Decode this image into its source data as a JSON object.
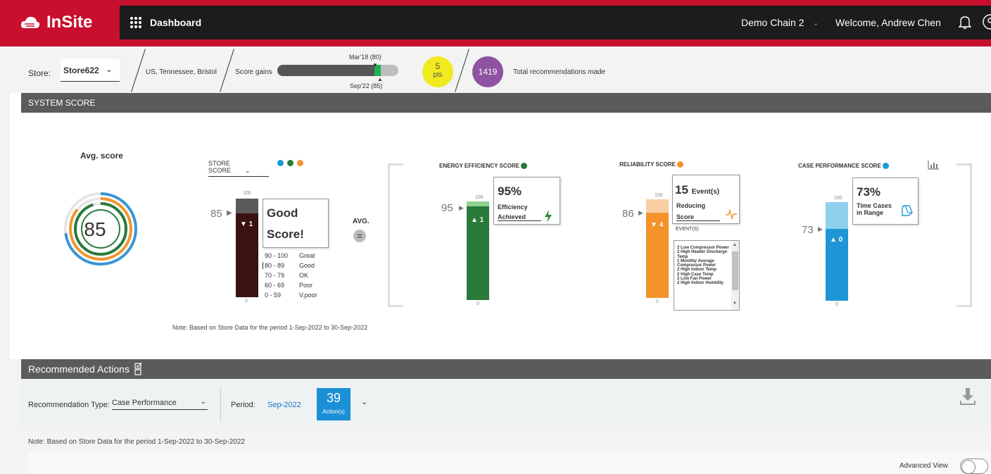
{
  "app": {
    "name": "InSite",
    "nav_title": "Dashboard",
    "chain": "Demo Chain 2",
    "welcome": "Welcome, Andrew Chen"
  },
  "store": {
    "label": "Store:",
    "value": "Store622",
    "location": "US, Tennessee, Bristol",
    "gains_label": "Score gains",
    "gains_top": "Mar'18 (80)",
    "gains_bottom": "Sep'22 (85)",
    "gains_fill": 0.8,
    "pts_value": "5",
    "pts_unit": "pts",
    "total_recs": "1419",
    "total_recs_label": "Total recommendations made"
  },
  "system_score": {
    "header": "SYSTEM SCORE",
    "avg_title": "Avg. score",
    "avg_value": "85",
    "store_score_label": "STORE SCORE",
    "store_value": "85",
    "store_delta": "▼ 1",
    "store_tick_top": "100",
    "store_tick_bottom": "0",
    "good_line1": "Good",
    "good_line2": "Score!",
    "legend": [
      {
        "range": "90 - 100",
        "label": "Great"
      },
      {
        "range": "80 - 89",
        "label": "Good"
      },
      {
        "range": "70 - 79",
        "label": "OK"
      },
      {
        "range": "60 - 69",
        "label": "Poor"
      },
      {
        "range": "0 - 59",
        "label": "V.poor"
      }
    ],
    "avg_label": "AVG.",
    "note": "Note: Based on Store Data for the period 1-Sep-2022 to 30-Sep-2022",
    "energy": {
      "title": "ENERGY EFFICIENCY SCORE",
      "value": "95",
      "delta": "▲ 1",
      "pct": "95%",
      "line1": "Efficiency",
      "line2": "Achieved",
      "tick_top": "100",
      "tick_bottom": "0"
    },
    "reliability": {
      "title": "RELIABILITY SCORE",
      "value": "86",
      "delta": "▼ 4",
      "count": "15",
      "count_unit": "Event(s)",
      "line1": "Reducing",
      "line2": "Score",
      "events_label": "EVENT(S)",
      "tick_top": "100",
      "tick_bottom": "0",
      "events": [
        "2 Low Compressor Power",
        "2 High Header Discharge Temp",
        "1 Monthly Average Compressor Power",
        "2 High Indoor Temp",
        "2 High Case Temp",
        "2 Low Fan Power",
        "2 High Indoor Humidity"
      ]
    },
    "case": {
      "title": "CASE PERFORMANCE SCORE",
      "value": "73",
      "delta": "▲ 0",
      "pct": "73%",
      "line1": "Time Cases",
      "line2": "in Range",
      "tick_top": "100",
      "tick_bottom": "0"
    }
  },
  "recommended": {
    "header": "Recommended Actions",
    "type_label": "Recommendation Type:",
    "type_value": "Case Performance",
    "period_label": "Period:",
    "period_value": "Sep-2022",
    "actions_count": "39",
    "actions_label": "Action(s)",
    "note": "Note: Based on Store Data for the period 1-Sep-2022 to 30-Sep-2022",
    "advanced_view": "Advanced View"
  },
  "colors": {
    "brand": "#c8102e",
    "green": "#2a7a3a",
    "orange": "#f5922a",
    "blue": "#1e96d6",
    "purple": "#8e53a1",
    "dark_red": "#3a1212"
  }
}
